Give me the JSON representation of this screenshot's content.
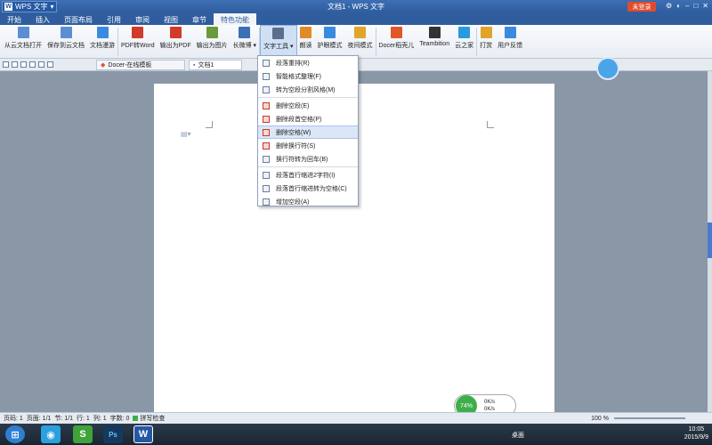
{
  "title": {
    "app": "WPS 文字",
    "document": "文档1 - WPS 文字",
    "login": "未登录"
  },
  "menu": [
    "开始",
    "插入",
    "页面布局",
    "引用",
    "审阅",
    "视图",
    "章节",
    "特色功能"
  ],
  "ribbon": [
    {
      "label": "从云文档打开",
      "icon": "cloud-open-icon",
      "color": "#5b8fd2"
    },
    {
      "label": "保存到云文档",
      "icon": "cloud-save-icon",
      "color": "#5b8fd2"
    },
    {
      "label": "文档漫游",
      "icon": "cloud-icon",
      "color": "#3a8be0"
    },
    {
      "label": "PDF转Word",
      "icon": "pdf-icon",
      "color": "#d23a2a"
    },
    {
      "label": "输出为PDF",
      "icon": "pdf-export-icon",
      "color": "#d23a2a"
    },
    {
      "label": "输出为图片",
      "icon": "image-export-icon",
      "color": "#6a9a3a"
    },
    {
      "label": "长微博 ▾",
      "icon": "weibo-icon",
      "color": "#3b6fb8"
    },
    {
      "label": "文字工具 ▾",
      "icon": "text-tool-icon",
      "color": "#5b6f8c"
    },
    {
      "label": "朗读",
      "icon": "read-aloud-icon",
      "color": "#e08a2a"
    },
    {
      "label": "护眼模式",
      "icon": "eye-icon",
      "color": "#3a8be0"
    },
    {
      "label": "夜间模式",
      "icon": "moon-icon",
      "color": "#e0a42a"
    },
    {
      "label": "Docer稻壳儿",
      "icon": "docer-icon",
      "color": "#e0582a"
    },
    {
      "label": "Teambition",
      "icon": "teambition-icon",
      "color": "#333333"
    },
    {
      "label": "云之家",
      "icon": "yunzhijia-icon",
      "color": "#2a9ae0"
    },
    {
      "label": "打赏",
      "icon": "reward-icon",
      "color": "#e0a42a"
    },
    {
      "label": "用户反馈",
      "icon": "feedback-icon",
      "color": "#3a8be0"
    }
  ],
  "tabs": {
    "docer": "Docer-在线模板",
    "doc": "文档1"
  },
  "dropdown": [
    {
      "label": "段落重排(R)",
      "red": false
    },
    {
      "label": "智能格式整理(F)",
      "red": false
    },
    {
      "label": "转为空段分割风格(M)",
      "red": false
    },
    {
      "sep": true
    },
    {
      "label": "删除空段(E)",
      "red": true
    },
    {
      "label": "删除段首空格(P)",
      "red": true
    },
    {
      "label": "删除空格(W)",
      "red": true,
      "hl": true
    },
    {
      "label": "删除换行符(S)",
      "red": true
    },
    {
      "label": "换行符转为回车(B)",
      "red": false
    },
    {
      "sep": true
    },
    {
      "label": "段落首行缩进2字符(I)",
      "red": false
    },
    {
      "label": "段落首行缩进转为空格(C)",
      "red": false
    },
    {
      "label": "增加空段(A)",
      "red": false
    }
  ],
  "status": {
    "page_no": "页码: 1",
    "pages": "页面: 1/1",
    "section": "节: 1/1",
    "row": "行: 1",
    "col": "列: 1",
    "words": "字数: 0",
    "spell": "拼写检查",
    "zoom": "100 %"
  },
  "net": {
    "percent": "74%",
    "up": "0K/s",
    "down": "0K/s"
  },
  "taskbar": {
    "desktop": "桌面",
    "time": "10:05",
    "date": "2015/9/9"
  }
}
